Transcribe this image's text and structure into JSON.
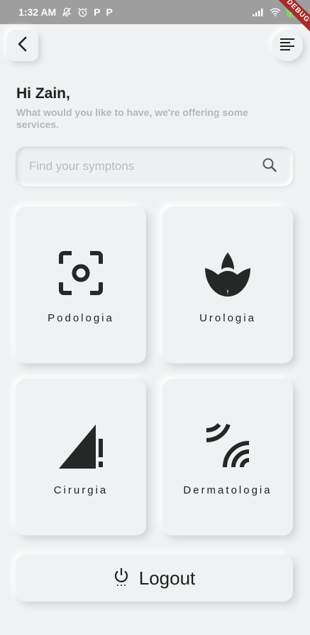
{
  "status_bar": {
    "time": "1:32 AM",
    "left_icons": [
      "bell-off-icon",
      "alarm-icon",
      "p-icon",
      "p-icon"
    ],
    "p_label": "P",
    "battery": "75",
    "right_icons": [
      "signal-icon",
      "wifi-icon",
      "battery-icon"
    ]
  },
  "debug_banner": "DEBUG",
  "header": {
    "back_icon": "chevron-left-icon",
    "menu_icon": "menu-lines-icon"
  },
  "greeting": {
    "title": "Hi Zain,",
    "subtitle": "What would you like to have, we're offering some services."
  },
  "search": {
    "placeholder": "Find your symptons",
    "value": "",
    "icon": "search-icon"
  },
  "services": [
    {
      "label": "Podologia",
      "icon": "focus-frame-icon"
    },
    {
      "label": "Urologia",
      "icon": "lotus-icon"
    },
    {
      "label": "Cirurgia",
      "icon": "signal-alert-icon"
    },
    {
      "label": "Dermatologia",
      "icon": "waves-icon"
    }
  ],
  "logout": {
    "label": "Logout",
    "icon": "power-icon"
  },
  "colors": {
    "background": "#eff1f2",
    "status_bar": "#9e9e9e",
    "text_dark": "#1f1f1f",
    "text_muted": "#b5b8ba",
    "debug_ribbon": "#a82a2a"
  }
}
